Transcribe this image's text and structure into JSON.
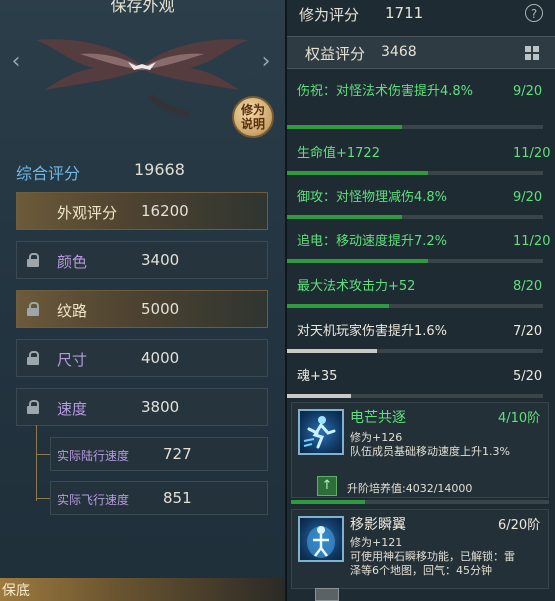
{
  "left": {
    "preview_title": "保存外观",
    "explain_button": "修为说明",
    "total": {
      "label": "综合评分",
      "value": "19668"
    },
    "attributes": [
      {
        "label": "外观评分",
        "value": "16200",
        "locked": false,
        "highlight": true
      },
      {
        "label": "颜色",
        "value": "3400",
        "locked": true,
        "highlight": false
      },
      {
        "label": "纹路",
        "value": "5000",
        "locked": true,
        "highlight": true
      },
      {
        "label": "尺寸",
        "value": "4000",
        "locked": true,
        "highlight": false
      },
      {
        "label": "速度",
        "value": "3800",
        "locked": true,
        "highlight": false
      }
    ],
    "sub_attributes": [
      {
        "label": "实际陆行速度",
        "value": "727"
      },
      {
        "label": "实际飞行速度",
        "value": "851"
      }
    ],
    "bottom_tab": "保底"
  },
  "right": {
    "title": "修为评分",
    "score": "1711",
    "help_icon": "?",
    "sub_title": "权益评分",
    "sub_score": "3468",
    "stats": [
      {
        "name": "伤祝：对怪法术伤害提升4.8%",
        "count": "9/20",
        "progress": 0.45,
        "color": "green"
      },
      {
        "name": "生命值+1722",
        "count": "11/20",
        "progress": 0.55,
        "color": "green"
      },
      {
        "name": "御攻：对怪物理减伤4.8%",
        "count": "9/20",
        "progress": 0.45,
        "color": "green"
      },
      {
        "name": "追电：移动速度提升7.2%",
        "count": "11/20",
        "progress": 0.55,
        "color": "green"
      },
      {
        "name": "最大法术攻击力+52",
        "count": "8/20",
        "progress": 0.4,
        "color": "green"
      },
      {
        "name": "对天机玩家伤害提升1.6%",
        "count": "7/20",
        "progress": 0.35,
        "color": "white"
      },
      {
        "name": "魂+35",
        "count": "5/20",
        "progress": 0.25,
        "color": "white"
      }
    ],
    "skills": [
      {
        "name": "电芒共逐",
        "level": "4/10阶",
        "lines": [
          "修为+126",
          "队伍成员基础移动速度上升1.3%"
        ],
        "upgrade_label": "升阶培养值:4032/14000",
        "upgrade_progress": 0.288,
        "color": "green"
      },
      {
        "name": "移影瞬翼",
        "level": "6/20阶",
        "lines": [
          "修为+121",
          "可使用神石瞬移功能，已解锁：雷",
          "泽等6个地图，回气：45分钟"
        ],
        "color": "white"
      }
    ]
  },
  "colors": {
    "accent_green": "#5fe07a",
    "accent_blue": "#6fb8e6",
    "accent_purple": "#b89adf",
    "gold": "#c9a469"
  },
  "icons": {
    "arrow_left": "‹",
    "arrow_right": "›",
    "upgrade": "↑"
  }
}
